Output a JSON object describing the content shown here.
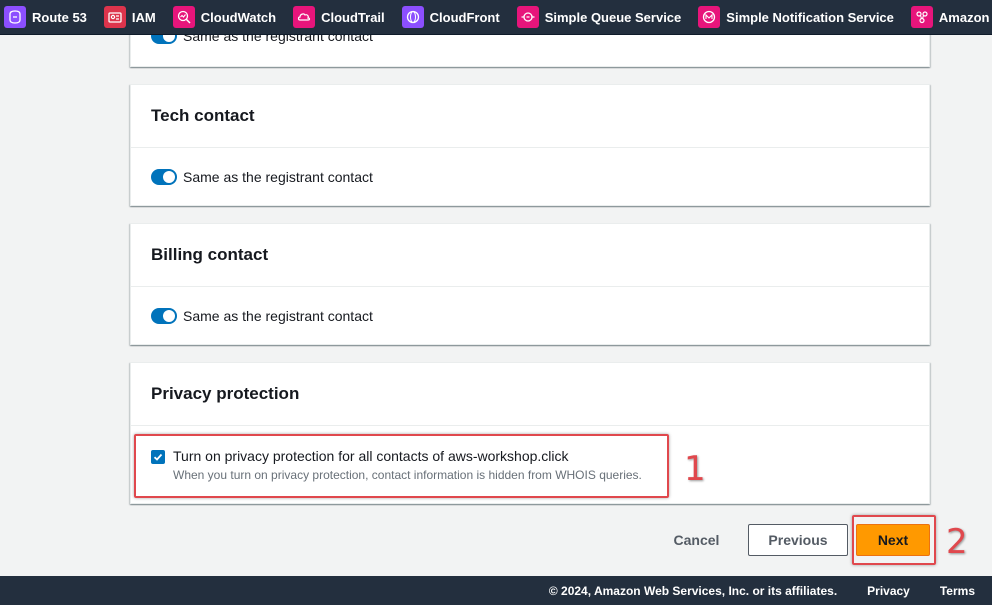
{
  "favorites": [
    {
      "label": "Route 53",
      "icon": "route53-icon",
      "color": "#8c4fff"
    },
    {
      "label": "IAM",
      "icon": "iam-icon",
      "color": "#dd344c"
    },
    {
      "label": "CloudWatch",
      "icon": "cloudwatch-icon",
      "color": "#e7157b"
    },
    {
      "label": "CloudTrail",
      "icon": "cloudtrail-icon",
      "color": "#e7157b"
    },
    {
      "label": "CloudFront",
      "icon": "cloudfront-icon",
      "color": "#8c4fff"
    },
    {
      "label": "Simple Queue Service",
      "icon": "sqs-icon",
      "color": "#e7157b"
    },
    {
      "label": "Simple Notification Service",
      "icon": "sns-icon",
      "color": "#e7157b"
    },
    {
      "label": "Amazon EventBridge",
      "icon": "eventbridge-icon",
      "color": "#e7157b"
    }
  ],
  "admin_contact": {
    "toggle_label": "Same as the registrant contact"
  },
  "tech_contact": {
    "title": "Tech contact",
    "toggle_label": "Same as the registrant contact"
  },
  "billing_contact": {
    "title": "Billing contact",
    "toggle_label": "Same as the registrant contact"
  },
  "privacy": {
    "title": "Privacy protection",
    "checkbox_label": "Turn on privacy protection for all contacts of aws-workshop.click",
    "checkbox_description": "When you turn on privacy protection, contact information is hidden from WHOIS queries.",
    "checked": true
  },
  "actions": {
    "cancel": "Cancel",
    "previous": "Previous",
    "next": "Next"
  },
  "annotations": {
    "step1": "1",
    "step2": "2"
  },
  "footer": {
    "copyright": "© 2024, Amazon Web Services, Inc. or its affiliates.",
    "privacy": "Privacy",
    "terms": "Terms"
  },
  "colors": {
    "accent": "#0073bb",
    "primary_button": "#ff9900",
    "annotation": "#e0484d",
    "nav_bg": "#232f3e"
  }
}
